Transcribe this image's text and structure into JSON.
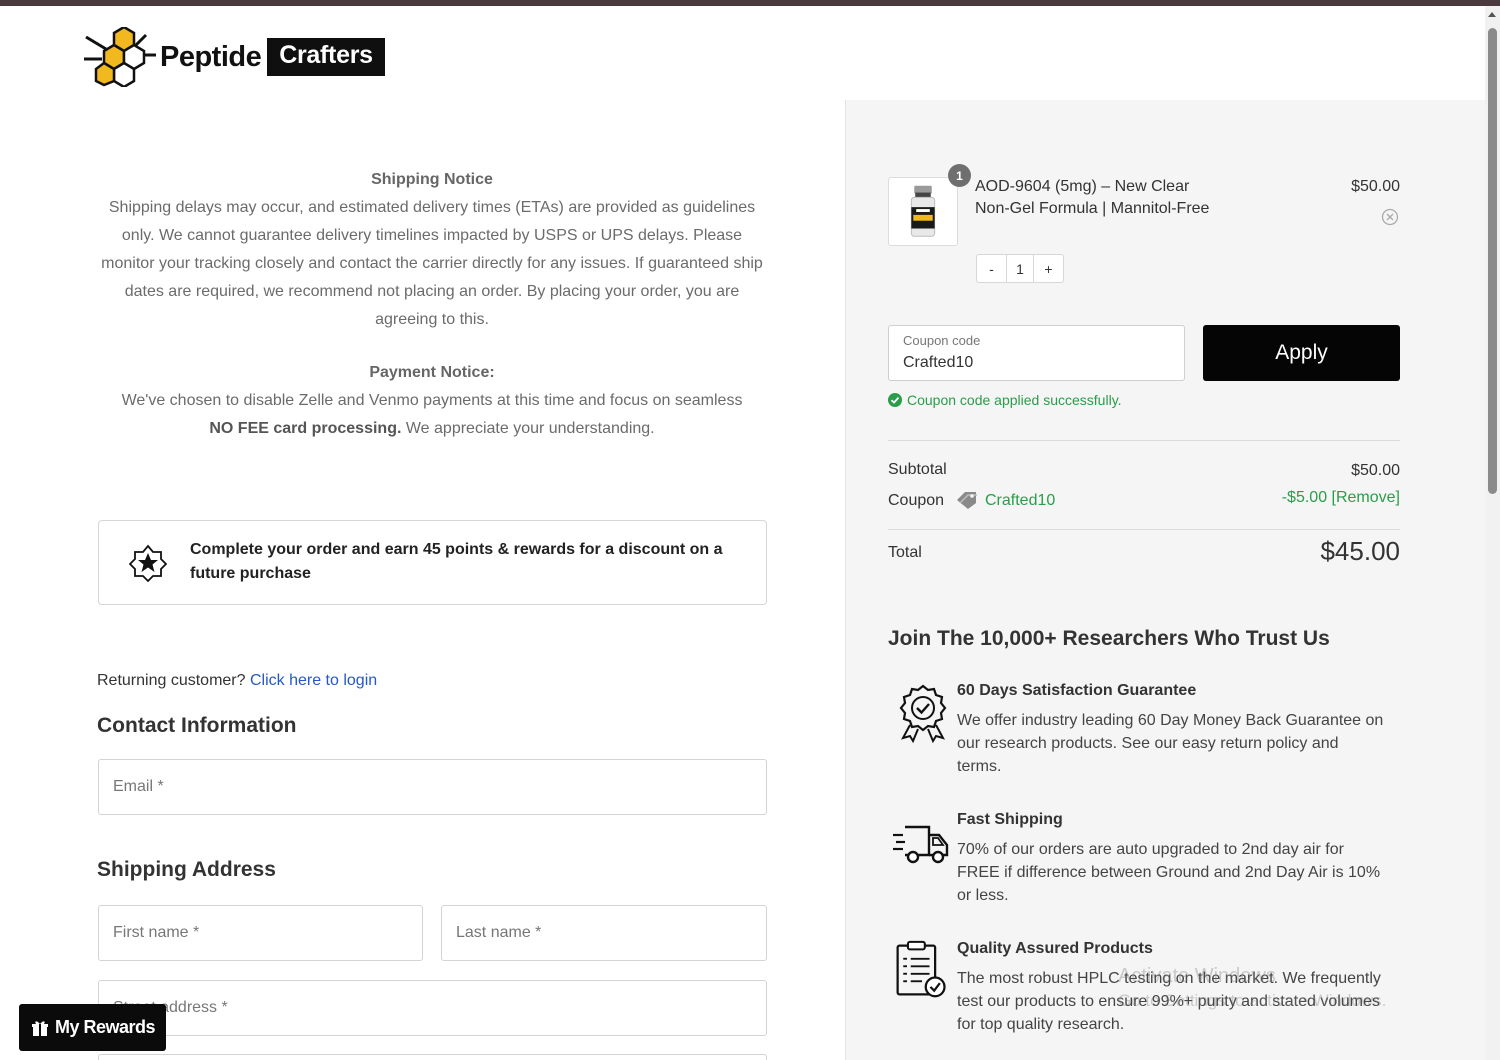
{
  "header": {
    "logo_word1": "Peptide",
    "logo_word2": "Crafters"
  },
  "notices": {
    "shipping_title": "Shipping Notice",
    "shipping_body": "Shipping delays may occur, and estimated delivery times (ETAs) are provided as guidelines only. We cannot guarantee delivery timelines impacted by USPS or UPS delays. Please monitor your tracking closely and contact the carrier directly for any issues. If guaranteed ship dates are required, we recommend not placing an order. By placing your order, you are agreeing to this.",
    "payment_title": "Payment Notice:",
    "payment_body_1": "We've chosen to disable Zelle and Venmo payments at this time and focus on seamless",
    "payment_body_bold": "NO FEE card processing.",
    "payment_body_2": " We appreciate your understanding."
  },
  "rewards_box": {
    "icon": "star-badge-icon",
    "text": "Complete your order and earn 45 points & rewards for a discount on a future purchase"
  },
  "returning": {
    "prompt": "Returning customer? ",
    "link": "Click here to login"
  },
  "contact": {
    "title": "Contact Information",
    "email_placeholder": "Email *"
  },
  "shipping": {
    "title": "Shipping Address",
    "first_name_placeholder": "First name *",
    "last_name_placeholder": "Last name *",
    "street_placeholder": "Street address *"
  },
  "my_rewards": {
    "label": "My Rewards",
    "icon": "gift-icon"
  },
  "cart": {
    "item": {
      "quantity_badge": "1",
      "name": "AOD-9604 (5mg) – New Clear Non-Gel Formula | Mannitol-Free",
      "price": "$50.00",
      "decrement": "-",
      "quantity": "1",
      "increment": "+"
    },
    "coupon": {
      "label": "Coupon code",
      "value": "Crafted10",
      "apply": "Apply",
      "success": "Coupon code applied successfully."
    },
    "summary": {
      "subtotal_label": "Subtotal",
      "subtotal_value": "$50.00",
      "coupon_label": "Coupon",
      "coupon_code": "Crafted10",
      "coupon_discount": "-$5.00 [Remove]",
      "total_label": "Total",
      "total_value": "$45.00"
    }
  },
  "trust": {
    "title": "Join The 10,000+ Researchers Who Trust Us",
    "items": [
      {
        "icon": "guarantee-badge-icon",
        "heading": "60 Days Satisfaction Guarantee",
        "body": "We offer industry leading 60 Day Money Back Guarantee on our research products. See our easy return policy and terms."
      },
      {
        "icon": "delivery-truck-icon",
        "heading": "Fast Shipping",
        "body": "70% of our orders are auto upgraded to 2nd day air for FREE if difference between Ground and 2nd Day Air is 10% or less."
      },
      {
        "icon": "checklist-icon",
        "heading": "Quality Assured Products",
        "body": "The most robust HPLC testing on the market. We frequently test our products to ensure 99%+ purity and stated volumes for top quality research."
      }
    ]
  },
  "watermark": {
    "line1": "Activate Windows",
    "line2": "Go to Settings to activate Windows."
  },
  "colors": {
    "accent_green": "#2a9d4a",
    "link_blue": "#2458c9",
    "apply_bg": "#050505",
    "logo_yellow": "#f2b820"
  }
}
